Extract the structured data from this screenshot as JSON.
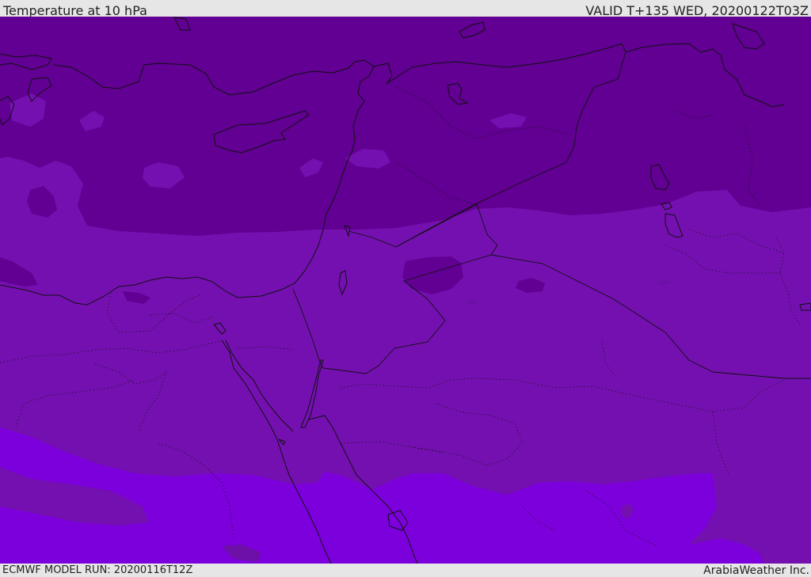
{
  "header": {
    "title": "Temperature at 10 hPa",
    "valid": "VALID T+135 WED, 20200122T03Z"
  },
  "footer": {
    "model_run": "ECMWF MODEL RUN: 20200116T12Z",
    "brand": "ArabiaWeather Inc."
  },
  "map": {
    "fill_colors": [
      "#610092",
      "#7410b0",
      "#7c00dc",
      "#6d10a8"
    ],
    "boundary_color": "#111111"
  }
}
